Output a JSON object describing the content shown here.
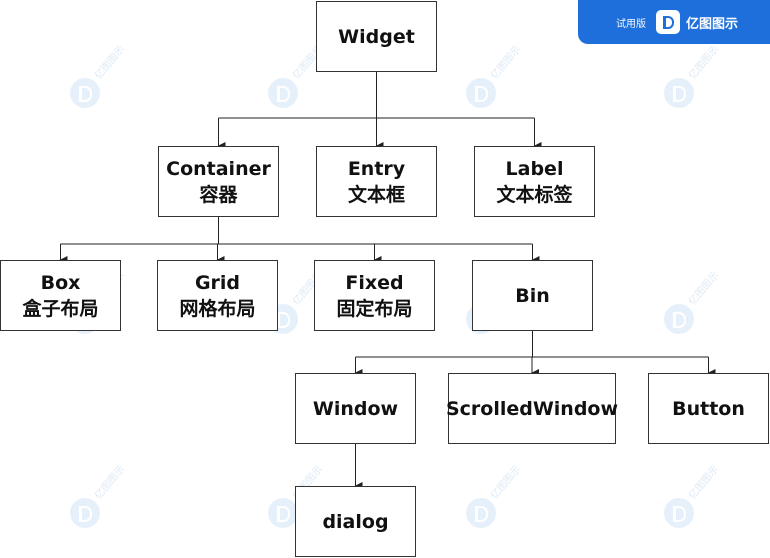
{
  "watermark": {
    "text": "亿图图示"
  },
  "banner": {
    "trial_label": "试用版",
    "brand_name": "亿图图示",
    "brand_icon": "edraw-logo-icon",
    "color": "#1e6fdc"
  },
  "colors": {
    "border": "#333333",
    "line": "#222222",
    "text": "#111111"
  },
  "nodes": {
    "widget": {
      "label": "Widget"
    },
    "container": {
      "label": "Container",
      "sublabel": "容器"
    },
    "entry": {
      "label": "Entry",
      "sublabel": "文本框"
    },
    "label": {
      "label": "Label",
      "sublabel": "文本标签"
    },
    "box": {
      "label": "Box",
      "sublabel": "盒子布局"
    },
    "grid": {
      "label": "Grid",
      "sublabel": "网格布局"
    },
    "fixed": {
      "label": "Fixed",
      "sublabel": "固定布局"
    },
    "bin": {
      "label": "Bin"
    },
    "window": {
      "label": "Window"
    },
    "scrolledwindow": {
      "label": "ScrolledWindow"
    },
    "button": {
      "label": "Button"
    },
    "dialog": {
      "label": "dialog"
    }
  },
  "edges": [
    [
      "widget",
      "container"
    ],
    [
      "widget",
      "entry"
    ],
    [
      "widget",
      "label"
    ],
    [
      "container",
      "box"
    ],
    [
      "container",
      "grid"
    ],
    [
      "container",
      "fixed"
    ],
    [
      "container",
      "bin"
    ],
    [
      "bin",
      "window"
    ],
    [
      "bin",
      "scrolledwindow"
    ],
    [
      "bin",
      "button"
    ],
    [
      "window",
      "dialog"
    ]
  ]
}
